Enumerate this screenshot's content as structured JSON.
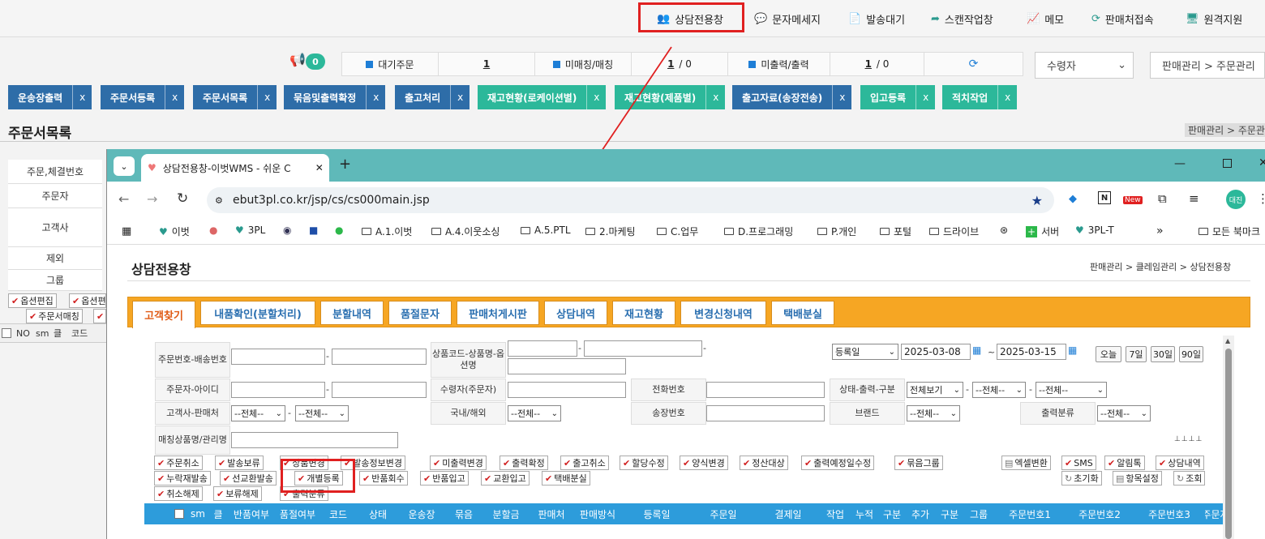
{
  "topnav": {
    "items": [
      {
        "label": "상담전용창",
        "icon": "users-icon"
      },
      {
        "label": "문자메세지",
        "icon": "chat-icon"
      },
      {
        "label": "발송대기",
        "icon": "document-icon"
      },
      {
        "label": "스캔작업창",
        "icon": "share-icon"
      },
      {
        "label": "메모",
        "icon": "chart-icon"
      },
      {
        "label": "판매처접속",
        "icon": "refresh-icon"
      },
      {
        "label": "원격지원",
        "icon": "monitor-icon"
      }
    ]
  },
  "notice": {
    "count": "0"
  },
  "status": {
    "waiting_label": "대기주문",
    "waiting_value": "1",
    "matching_label": "미매칭/매칭",
    "matching_value": "1",
    "matching_suffix": " / 0",
    "printing_label": "미출력/출력",
    "printing_value": "1",
    "printing_suffix": " / 0"
  },
  "receiver_select": "수령자",
  "breadcrumb_top": "판매관리 > 주문관리",
  "menu_tabs": [
    {
      "label": "운송장출력",
      "color": "blue"
    },
    {
      "label": "주문서등록",
      "color": "blue"
    },
    {
      "label": "주문서목록",
      "color": "blue"
    },
    {
      "label": "묶음및출력확정",
      "color": "blue"
    },
    {
      "label": "출고처리",
      "color": "blue"
    },
    {
      "label": "재고현황(로케이션별)",
      "color": "green"
    },
    {
      "label": "재고현황(제품별)",
      "color": "green"
    },
    {
      "label": "출고자료(송장전송)",
      "color": "blue"
    },
    {
      "label": "입고등록",
      "color": "green"
    },
    {
      "label": "적치작업",
      "color": "green"
    }
  ],
  "menu_close": "x",
  "bg_page": {
    "title": "주문서목록",
    "breadcrumb": "판매관리 > 주문관",
    "labels": [
      "주문,체결번호",
      "주문자",
      "고객사",
      "제외",
      "그룹"
    ],
    "buttons": [
      "옵션편집",
      "옵션편",
      "주문서매칭"
    ],
    "cols": [
      "NO",
      "sm",
      "클",
      "코드"
    ]
  },
  "browser": {
    "tab_title": "상담전용창-이벗WMS - 쉬운 C",
    "url": "ebut3pl.co.kr/jsp/cs/cs000main.jsp",
    "new_badge": "New",
    "profile": "대진",
    "bookmarks": [
      "이벗",
      "3PL",
      "A.1.이벗",
      "A.4.이웃소싱",
      "A.5.PTL",
      "2.마케팅",
      "C.업무",
      "D.프로그래밍",
      "P.개인",
      "포털",
      "드라이브",
      "서버",
      "3PL-T",
      "모든 북마크"
    ],
    "more": "»"
  },
  "cs": {
    "title": "상담전용창",
    "breadcrumb": "판매관리 > 클레임관리 > 상담전용창",
    "tabs": [
      "고객찾기",
      "내품확인(분할처리)",
      "분할내역",
      "품절문자",
      "판매처게시판",
      "상담내역",
      "재고현황",
      "변경신청내역",
      "택배분실"
    ],
    "form": {
      "order_no": "주문번호-배송번호",
      "product": "상품코드-상품명-옵션명",
      "orderer": "주문자-아이디",
      "receiver": "수령자(주문자)",
      "phone": "전화번호",
      "state": "상태-출력-구분",
      "client": "고객사-판매처",
      "domestic": "국내/해외",
      "invoice": "송장번호",
      "brand": "브랜드",
      "print_class": "출력분류",
      "matching": "매칭상품명/관리명",
      "date_type": "등록일",
      "date_from": "2025-03-08",
      "date_sep": "~",
      "date_to": "2025-03-15",
      "quick": [
        "오늘",
        "7일",
        "30일",
        "90일"
      ],
      "all": "--전체--",
      "view_all": "전체보기",
      "sep": "-"
    },
    "btn_row1": [
      "주문취소",
      "발송보류",
      "상품변경",
      "발송정보변경",
      "미출력변경",
      "출력확정",
      "출고취소",
      "할당수정",
      "양식변경",
      "정산대상",
      "출력예정일수정",
      "묶음그룹"
    ],
    "btn_row1_right": [
      "엑셀변환",
      "SMS",
      "알림톡",
      "상담내역"
    ],
    "btn_row2": [
      "누락재발송",
      "선교환발송",
      "개별등록",
      "반품회수",
      "반품입고",
      "교환입고",
      "택배분실"
    ],
    "btn_row2_right": [
      "초기화",
      "항목설정",
      "조회"
    ],
    "btn_row3": [
      "취소해제",
      "보류해제",
      "출력분류"
    ],
    "table_headers": [
      "sm",
      "클",
      "반품여부",
      "품절여부",
      "코드",
      "상태",
      "운송장",
      "묶음",
      "분할금",
      "판매처",
      "판매방식",
      "등록일",
      "주문일",
      "결제일",
      "작업",
      "누적",
      "구분",
      "추가",
      "구분",
      "그룹",
      "주문번호1",
      "주문번호2",
      "주문번호3",
      "주문자"
    ]
  },
  "colors": {
    "accent_red": "#e02020",
    "teal": "#5fb9b9",
    "orange": "#f6a623",
    "blue_tab": "#2e6da8",
    "green_tab": "#2cb89a",
    "table_header": "#2d9cdb"
  }
}
